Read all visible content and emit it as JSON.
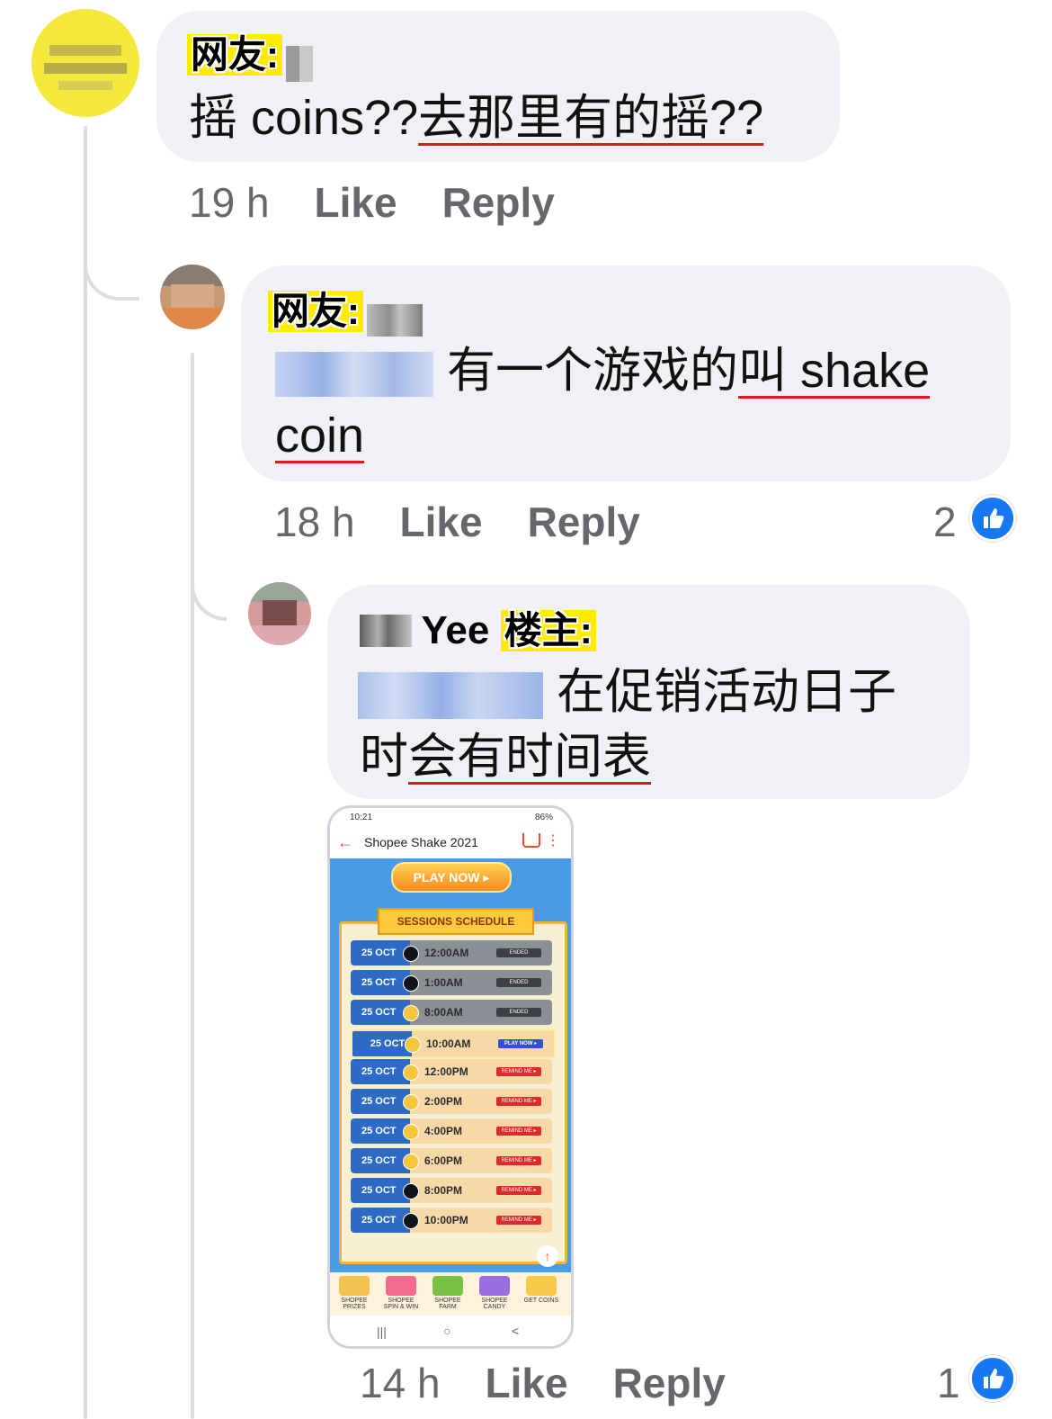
{
  "comments": [
    {
      "tag": "网友:",
      "body_plain": "摇 coins??",
      "body_underlined": "去那里有的摇??",
      "time": "19 h",
      "like": "Like",
      "reply": "Reply"
    },
    {
      "tag": "网友:",
      "body_plain": " 有一个游戏的",
      "body_underlined_1": "叫 shake",
      "body_underlined_2": "coin",
      "time": "18 h",
      "like": "Like",
      "reply": "Reply",
      "reaction_count": "2"
    },
    {
      "name": "Yee",
      "tag": "楼主:",
      "body_plain": " 在促销活动日子",
      "body_line2_plain": "时",
      "body_underlined": "会有时间表",
      "time": "14 h",
      "like": "Like",
      "reply": "Reply",
      "reaction_count": "1"
    }
  ],
  "phone": {
    "status_time": "10:21",
    "status_battery": "86%",
    "title": "Shopee Shake 2021",
    "play_now": "PLAY NOW ▸",
    "schedule_title": "SESSIONS SCHEDULE",
    "sessions": [
      {
        "date": "25 OCT",
        "time": "12:00AM",
        "status": "ENDED"
      },
      {
        "date": "25 OCT",
        "time": "1:00AM",
        "status": "ENDED"
      },
      {
        "date": "25 OCT",
        "time": "8:00AM",
        "status": "ENDED"
      },
      {
        "date": "25 OCT",
        "time": "10:00AM",
        "status": "PLAY NOW ▸"
      },
      {
        "date": "25 OCT",
        "time": "12:00PM",
        "status": "REMIND ME ▸"
      },
      {
        "date": "25 OCT",
        "time": "2:00PM",
        "status": "REMIND ME ▸"
      },
      {
        "date": "25 OCT",
        "time": "4:00PM",
        "status": "REMIND ME ▸"
      },
      {
        "date": "25 OCT",
        "time": "6:00PM",
        "status": "REMIND ME ▸"
      },
      {
        "date": "25 OCT",
        "time": "8:00PM",
        "status": "REMIND ME ▸"
      },
      {
        "date": "25 OCT",
        "time": "10:00PM",
        "status": "REMIND ME ▸"
      }
    ],
    "bottom_items": [
      "SHOPEE PRIZES",
      "SHOPEE SPIN & WIN",
      "SHOPEE FARM",
      "SHOPEE CANDY",
      "GET COINS"
    ],
    "nav": [
      "|||",
      "○",
      "<"
    ]
  }
}
